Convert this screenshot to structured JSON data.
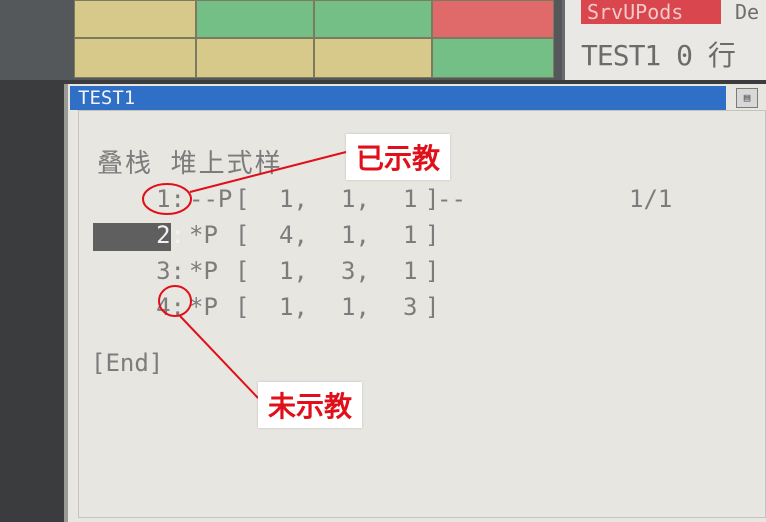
{
  "top_status": {
    "badge_text": "SrvUPods",
    "side_text": "De",
    "program_line": "TEST1 0 行"
  },
  "window": {
    "title": "TEST1",
    "program_comment": "叠栈 堆上式样"
  },
  "program": {
    "page_indicator": "1/1",
    "lines": [
      {
        "num": "1",
        "sep": ":",
        "mark": "--P",
        "open": "[",
        "v1": "1,",
        "v2": "1,",
        "v3": "1",
        "close": "]",
        "tail": "--"
      },
      {
        "num": "2",
        "sep": ":",
        "mark": "*P",
        "open": "[",
        "v1": "4,",
        "v2": "1,",
        "v3": "1",
        "close": "]",
        "tail": ""
      },
      {
        "num": "3",
        "sep": ":",
        "mark": "*P",
        "open": "[",
        "v1": "1,",
        "v2": "3,",
        "v3": "1",
        "close": "]",
        "tail": ""
      },
      {
        "num": "4",
        "sep": ":",
        "mark": "*P",
        "open": "[",
        "v1": "1,",
        "v2": "1,",
        "v3": "3",
        "close": "]",
        "tail": ""
      }
    ],
    "selected_line": 2,
    "end_marker": "[End]"
  },
  "annotations": {
    "taught_label": "已示教",
    "untaught_label": "未示教"
  },
  "colors": {
    "title_bar": "#2f6fc5",
    "annotation_red": "#e0101a",
    "status_red": "#d9464e",
    "cell_green": "#74bf86",
    "cell_yellow": "#d7c98a"
  }
}
